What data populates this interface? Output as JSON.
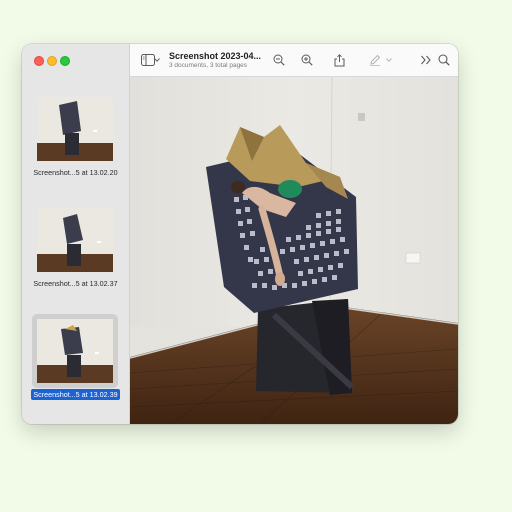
{
  "window": {
    "title": "Screenshot 2023-04...",
    "subtitle": "3 documents, 3 total pages"
  },
  "toolbar": {
    "icons": [
      "sidebar-toggle-icon",
      "chevron-down-icon",
      "zoom-out-icon",
      "zoom-in-icon",
      "share-icon",
      "markup-pen-icon",
      "chevron-down-icon",
      "more-chevrons-icon",
      "search-icon"
    ]
  },
  "sidebar": {
    "items": [
      {
        "label": "Screenshot...5 at 13.02.20",
        "selected": false
      },
      {
        "label": "Screenshot...5 at 13.02.37",
        "selected": false
      },
      {
        "label": "Screenshot...5 at 13.02.39",
        "selected": true
      }
    ]
  },
  "colors": {
    "selection": "#1b62d4",
    "background": "#f2fbe8"
  }
}
